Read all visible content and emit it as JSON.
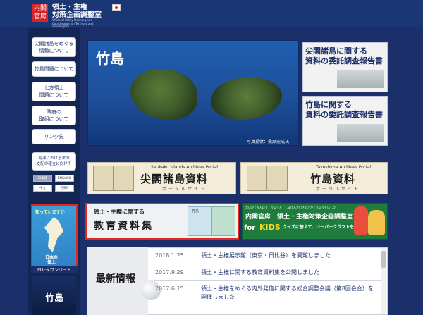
{
  "header": {
    "logo_line1": "内閣",
    "logo_line2": "官房",
    "title_line1": "領土・主権",
    "title_line2": "対策企画調整室",
    "subtitle": "Office of Policy Planning and Coordination on Territory and Sovereignty"
  },
  "sidebar": {
    "items": [
      {
        "label": "尖閣諸島をめぐる\n情勢について"
      },
      {
        "label": "竹島問題について"
      },
      {
        "label": "北方領土\n問題について"
      },
      {
        "label": "政府の\n取組について"
      },
      {
        "label": "リンク先"
      },
      {
        "label": "海洋における法の\n支配の確立に向けて"
      }
    ],
    "lang": {
      "ja": "日本語",
      "en": "ENGLISH",
      "zh": "中文",
      "ko": "한국어"
    }
  },
  "pamphlet": {
    "heading": "知っていますか",
    "body_line1": "日本の",
    "body_line2": "領土",
    "download": "PDFダウンロード"
  },
  "takeshima_pamphlet": {
    "title": "竹島"
  },
  "hero": {
    "title": "竹島",
    "credit": "写真提供：桑原史成氏"
  },
  "reports": [
    {
      "text": "尖閣諸島に関する\n資料の委託調査報告書"
    },
    {
      "text": "竹島に関する\n資料の委託調査報告書"
    }
  ],
  "portals": [
    {
      "en": "Senkaku Islands Archives Portal",
      "big": "尖閣諸島資料",
      "sub": "ポータルサイト"
    },
    {
      "en": "Takeshima Archives Portal",
      "big": "竹島資料",
      "sub": "ポータルサイト"
    }
  ],
  "education": {
    "line1": "領土・主権に関する",
    "line2": "教育資料集",
    "doc_label": "竹島"
  },
  "kids": {
    "top": "ないかくかんぼう　りょうど　しゅけんたいさくきかくちょうせいしつ",
    "mid": "内閣官房　領土・主権対策企画調整室",
    "for": "for",
    "kids_word": "KIDS",
    "quiz": "クイズに答えて、ペーパークラフトを作ろう！"
  },
  "news": {
    "title": "最新情報",
    "items": [
      {
        "date": "2018.1.25",
        "text": "領土・主権展示館（東京・日比谷）を開館しました"
      },
      {
        "date": "2017.9.29",
        "text": "領土・主権に関する教育資料集を公開しました"
      },
      {
        "date": "2017.6.15",
        "text": "領土・主権をめぐる内外発信に関する総合調整会議（第8回会合）を",
        "text2": "開催しました"
      }
    ]
  },
  "colors": {
    "navy": "#1b2f6b",
    "red_border": "#e5261d",
    "kids_green": "#1e7c3f"
  }
}
